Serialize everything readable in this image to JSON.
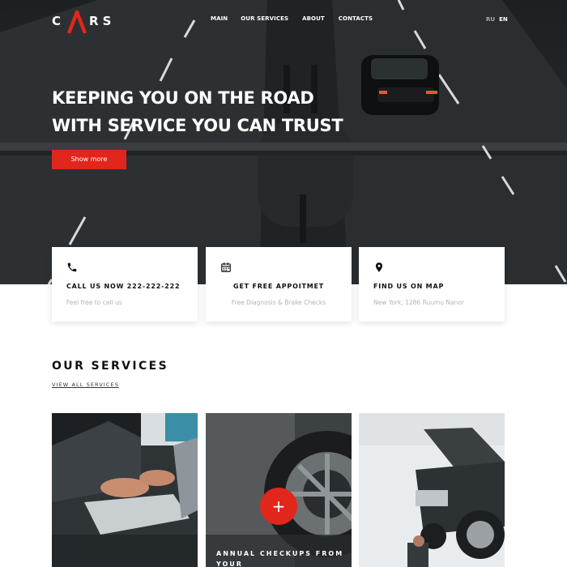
{
  "brand": {
    "logo_left": "C",
    "logo_right": "RS",
    "accent": "#e1261c"
  },
  "nav": {
    "items": [
      "MAIN",
      "OUR SERVICES",
      "ABOUT",
      "CONTACTS"
    ]
  },
  "lang": {
    "ru": "RU",
    "en": "EN"
  },
  "hero": {
    "headline_line1": "KEEPING YOU ON THE ROAD",
    "headline_line2": "WITH SERVICE YOU CAN TRUST",
    "button_label": "Show more"
  },
  "info_cards": [
    {
      "icon": "phone-icon",
      "title": "CALL US NOW 222-222-222",
      "subtitle": "Feel free to call us"
    },
    {
      "icon": "calendar-icon",
      "title": "GET FREE APPOITMET",
      "subtitle": "Free Diagnosis & Brake Checks"
    },
    {
      "icon": "map-pin-icon",
      "title": "FIND US ON MAP",
      "subtitle": "New York, 1286 Ruumu Nanor"
    }
  ],
  "services": {
    "title": "OUR SERVICES",
    "view_all": "VIEW ALL SERVICES",
    "tiles": [
      {
        "image": "laptop-diagnostics"
      },
      {
        "image": "wheel-service",
        "action_icon": "plus-icon",
        "action_label": "+",
        "caption": "ANNUAL CHECKUPS FROM YOUR"
      },
      {
        "image": "car-lift-repair"
      }
    ]
  }
}
